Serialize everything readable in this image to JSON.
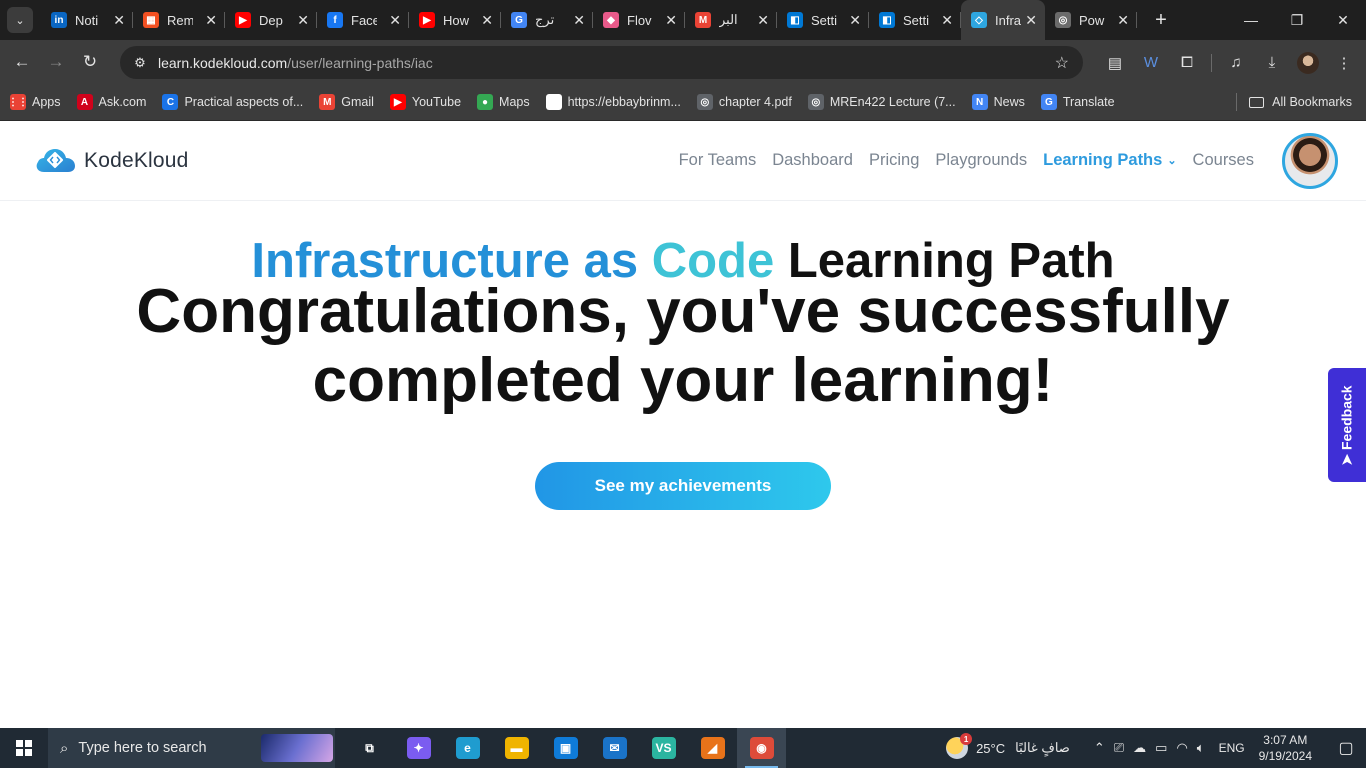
{
  "browser": {
    "tabs": [
      {
        "title": "Noti",
        "icon": "linkedin-icon",
        "color": "#0a66c2",
        "glyph": "in"
      },
      {
        "title": "Rem",
        "icon": "microsoft-icon",
        "color": "#f25022",
        "glyph": "▦"
      },
      {
        "title": "Dep",
        "icon": "youtube-icon",
        "color": "#ff0000",
        "glyph": "▶"
      },
      {
        "title": "Face",
        "icon": "facebook-icon",
        "color": "#1877f2",
        "glyph": "f"
      },
      {
        "title": "How",
        "icon": "youtube-icon",
        "color": "#ff0000",
        "glyph": "▶"
      },
      {
        "title": "ترج",
        "icon": "google-translate-icon",
        "color": "#4285f4",
        "glyph": "G"
      },
      {
        "title": "Flov",
        "icon": "flow-icon",
        "color": "#e85a8a",
        "glyph": "◆"
      },
      {
        "title": "البر",
        "icon": "gmail-icon",
        "color": "#ea4335",
        "glyph": "M"
      },
      {
        "title": "Setti",
        "icon": "azure-devops-icon",
        "color": "#0078d4",
        "glyph": "◧"
      },
      {
        "title": "Setti",
        "icon": "azure-devops-icon",
        "color": "#0078d4",
        "glyph": "◧"
      },
      {
        "title": "Infra",
        "icon": "kodekloud-icon",
        "color": "#2ea6e0",
        "glyph": "◇",
        "active": true
      },
      {
        "title": "Pow",
        "icon": "globe-icon",
        "color": "#6b6b6b",
        "glyph": "◎"
      }
    ],
    "url_domain": "learn.kodekloud.com",
    "url_path": "/user/learning-paths/iac",
    "bookmarks": [
      {
        "label": "Apps",
        "icon": "apps-grid-icon",
        "color": "#e94235",
        "glyph": "⋮⋮"
      },
      {
        "label": "Ask.com",
        "icon": "ask-icon",
        "color": "#d0021b",
        "glyph": "A"
      },
      {
        "label": "Practical aspects of...",
        "icon": "c-icon",
        "color": "#1a73e8",
        "glyph": "C"
      },
      {
        "label": "Gmail",
        "icon": "gmail-icon",
        "color": "#ea4335",
        "glyph": "M"
      },
      {
        "label": "YouTube",
        "icon": "youtube-icon",
        "color": "#ff0000",
        "glyph": "▶"
      },
      {
        "label": "Maps",
        "icon": "maps-pin-icon",
        "color": "#34a853",
        "glyph": "●"
      },
      {
        "label": "https://ebbaybrinm...",
        "icon": "blank-page-icon",
        "color": "#ffffff",
        "glyph": ""
      },
      {
        "label": "chapter 4.pdf",
        "icon": "globe-icon",
        "color": "#5f6368",
        "glyph": "◎"
      },
      {
        "label": "MREn422 Lecture (7...",
        "icon": "globe-icon",
        "color": "#5f6368",
        "glyph": "◎"
      },
      {
        "label": "News",
        "icon": "google-news-icon",
        "color": "#4285f4",
        "glyph": "N"
      },
      {
        "label": "Translate",
        "icon": "google-translate-icon",
        "color": "#4285f4",
        "glyph": "G"
      }
    ],
    "all_bookmarks": "All Bookmarks"
  },
  "site": {
    "logo_text": "KodeKloud",
    "nav": [
      {
        "label": "For Teams"
      },
      {
        "label": "Dashboard"
      },
      {
        "label": "Pricing"
      },
      {
        "label": "Playgrounds"
      },
      {
        "label": "Learning Paths",
        "active": true
      },
      {
        "label": "Courses"
      }
    ],
    "accent_color": "#2e9bde"
  },
  "main": {
    "heading_highlight_1": "Infrastructure as",
    "heading_highlight_2": "Code",
    "heading_rest": "Learning Path",
    "congrats_line": "Congratulations, you've successfully completed your learning!",
    "cta_label": "See my achievements",
    "feedback_label": "➤ Feedback"
  },
  "taskbar": {
    "search_placeholder": "Type here to search",
    "apps": [
      {
        "name": "task-view-icon",
        "color": "#202a34",
        "glyph": "⧉"
      },
      {
        "name": "copilot-icon",
        "color": "#7b5cf0",
        "glyph": "✦"
      },
      {
        "name": "edge-icon",
        "color": "#1f9ccf",
        "glyph": "e"
      },
      {
        "name": "file-explorer-icon",
        "color": "#f0b400",
        "glyph": "▬"
      },
      {
        "name": "microsoft-store-icon",
        "color": "#0f7bd8",
        "glyph": "▣"
      },
      {
        "name": "mail-icon",
        "color": "#1a73c8",
        "glyph": "✉"
      },
      {
        "name": "visual-studio-icon",
        "color": "#2bb5a0",
        "glyph": "VS"
      },
      {
        "name": "matlab-icon",
        "color": "#e8731a",
        "glyph": "◢"
      },
      {
        "name": "chrome-icon",
        "color": "#dd4b39",
        "glyph": "◉",
        "active": true
      }
    ],
    "temperature": "25°C",
    "weather_text": "صافٍ غالبًا",
    "weather_badge": "1",
    "language": "ENG",
    "time": "3:07 AM",
    "date": "9/19/2024"
  }
}
